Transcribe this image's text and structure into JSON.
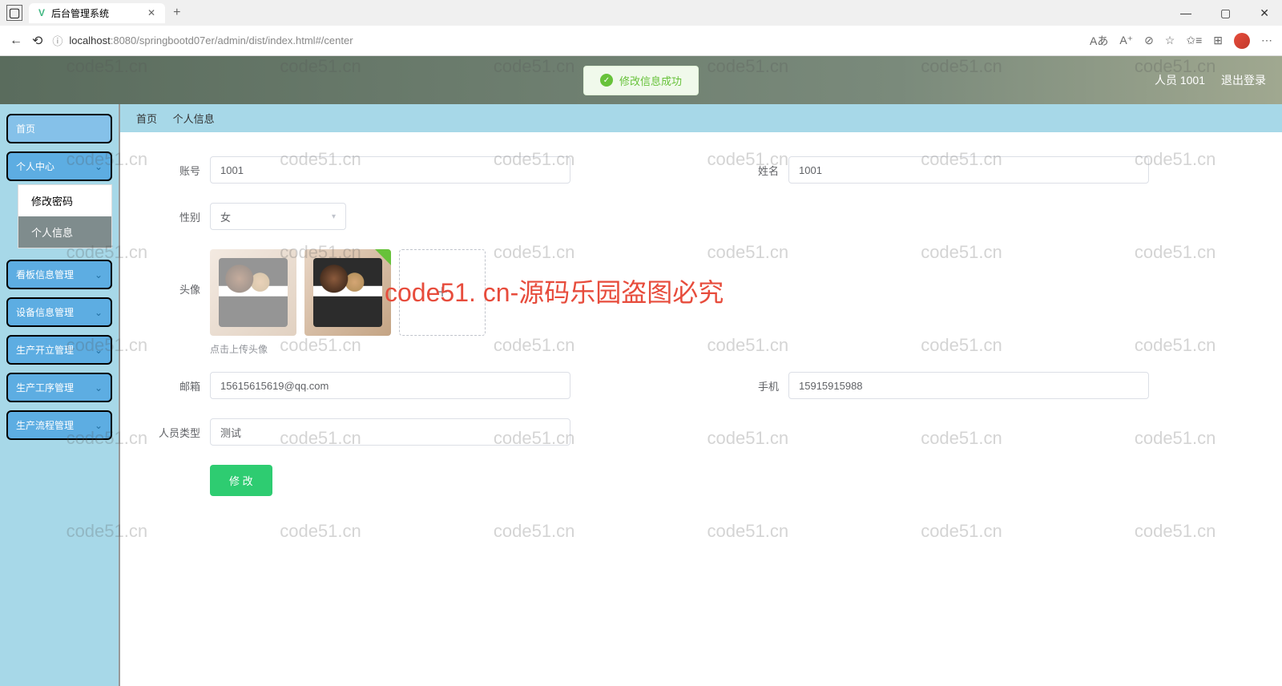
{
  "browser": {
    "tab_title": "后台管理系统",
    "url_host": "localhost",
    "url_port": ":8080",
    "url_path": "/springbootd07er/admin/dist/index.html#/center"
  },
  "toast": {
    "message": "修改信息成功"
  },
  "header": {
    "user_label": "人员 1001",
    "logout": "退出登录"
  },
  "sidebar": {
    "home": "首页",
    "items": [
      {
        "label": "个人中心"
      },
      {
        "label": "看板信息管理"
      },
      {
        "label": "设备信息管理"
      },
      {
        "label": "生产开立管理"
      },
      {
        "label": "生产工序管理"
      },
      {
        "label": "生产流程管理"
      }
    ],
    "submenu": {
      "change_pwd": "修改密码",
      "profile": "个人信息"
    }
  },
  "breadcrumb": {
    "home": "首页",
    "current": "个人信息"
  },
  "form": {
    "labels": {
      "account": "账号",
      "name": "姓名",
      "gender": "性别",
      "avatar": "头像",
      "email": "邮箱",
      "phone": "手机",
      "role": "人员类型"
    },
    "values": {
      "account": "1001",
      "name": "1001",
      "gender": "女",
      "email": "15615615619@qq.com",
      "phone": "15915915988",
      "role": "测试"
    },
    "upload_tip": "点击上传头像",
    "submit": "修 改"
  },
  "watermark": {
    "small": "code51.cn",
    "big": "code51. cn-源码乐园盗图必究"
  }
}
